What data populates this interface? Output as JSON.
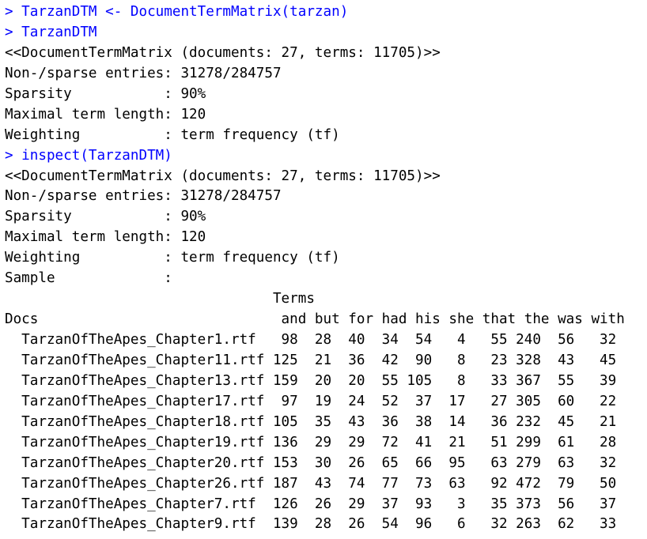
{
  "console": {
    "lines": [
      {
        "kind": "input",
        "text": "> TarzanDTM <- DocumentTermMatrix(tarzan)"
      },
      {
        "kind": "input",
        "text": "> TarzanDTM"
      },
      {
        "kind": "output",
        "text": "<<DocumentTermMatrix (documents: 27, terms: 11705)>>"
      },
      {
        "kind": "output",
        "text": "Non-/sparse entries: 31278/284757"
      },
      {
        "kind": "output",
        "text": "Sparsity           : 90%"
      },
      {
        "kind": "output",
        "text": "Maximal term length: 120"
      },
      {
        "kind": "output",
        "text": "Weighting          : term frequency (tf)"
      },
      {
        "kind": "input",
        "text": "> inspect(TarzanDTM)"
      },
      {
        "kind": "output",
        "text": "<<DocumentTermMatrix (documents: 27, terms: 11705)>>"
      },
      {
        "kind": "output",
        "text": "Non-/sparse entries: 31278/284757"
      },
      {
        "kind": "output",
        "text": "Sparsity           : 90%"
      },
      {
        "kind": "output",
        "text": "Maximal term length: 120"
      },
      {
        "kind": "output",
        "text": "Weighting          : term frequency (tf)"
      },
      {
        "kind": "output",
        "text": "Sample             :"
      },
      {
        "kind": "output",
        "text": "                                Terms"
      },
      {
        "kind": "output",
        "text": "Docs                             and but for had his she that the was with"
      },
      {
        "kind": "output",
        "text": "  TarzanOfTheApes_Chapter1.rtf   98  28  40  34  54   4   55 240  56   32"
      },
      {
        "kind": "output",
        "text": "  TarzanOfTheApes_Chapter11.rtf 125  21  36  42  90   8   23 328  43   45"
      },
      {
        "kind": "output",
        "text": "  TarzanOfTheApes_Chapter13.rtf 159  20  20  55 105   8   33 367  55   39"
      },
      {
        "kind": "output",
        "text": "  TarzanOfTheApes_Chapter17.rtf  97  19  24  52  37  17   27 305  60   22"
      },
      {
        "kind": "output",
        "text": "  TarzanOfTheApes_Chapter18.rtf 105  35  43  36  38  14   36 232  45   21"
      },
      {
        "kind": "output",
        "text": "  TarzanOfTheApes_Chapter19.rtf 136  29  29  72  41  21   51 299  61   28"
      },
      {
        "kind": "output",
        "text": "  TarzanOfTheApes_Chapter20.rtf 153  30  26  65  66  95   63 279  63   32"
      },
      {
        "kind": "output",
        "text": "  TarzanOfTheApes_Chapter26.rtf 187  43  74  77  73  63   92 472  79   50"
      },
      {
        "kind": "output",
        "text": "  TarzanOfTheApes_Chapter7.rtf  126  26  29  37  93   3   35 373  56   37"
      },
      {
        "kind": "output",
        "text": "  TarzanOfTheApes_Chapter9.rtf  139  28  26  54  96   6   32 263  62   33"
      }
    ]
  }
}
